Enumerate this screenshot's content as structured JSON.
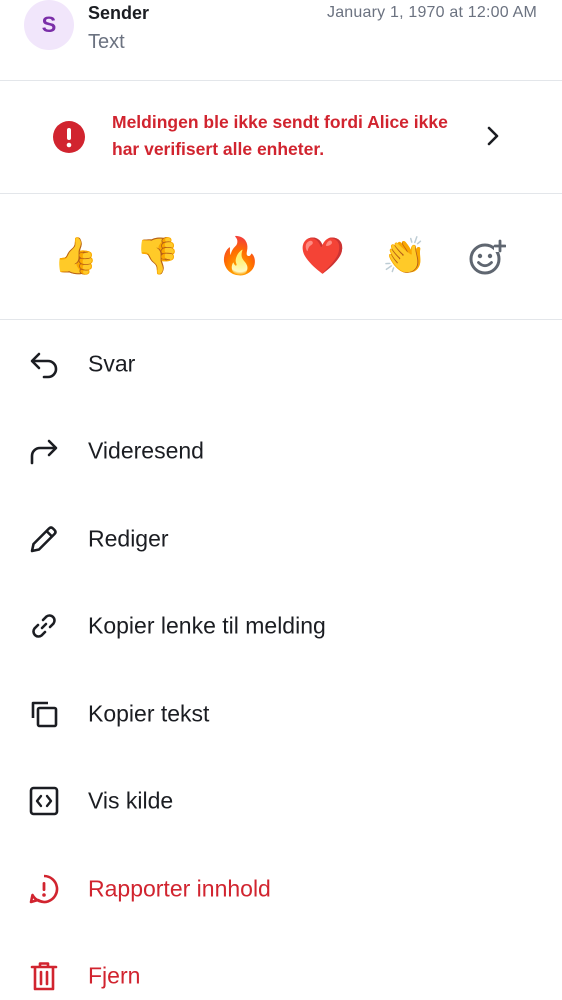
{
  "message": {
    "avatar_letter": "S",
    "sender": "Sender",
    "text": "Text",
    "timestamp": "January 1, 1970 at 12:00 AM"
  },
  "warning": {
    "text": "Meldingen ble ikke sendt fordi Alice ikke har verifisert alle enheter."
  },
  "reactions": [
    "👍",
    "👎",
    "🔥",
    "❤️",
    "👏"
  ],
  "menu": {
    "reply": "Svar",
    "forward": "Videresend",
    "edit": "Rediger",
    "copy_link": "Kopier lenke til melding",
    "copy_text": "Kopier tekst",
    "view_source": "Vis kilde",
    "report": "Rapporter innhold",
    "remove": "Fjern"
  },
  "colors": {
    "danger": "#d1242f",
    "avatar_bg": "#f1e6fb",
    "avatar_fg": "#7a2ea8"
  }
}
